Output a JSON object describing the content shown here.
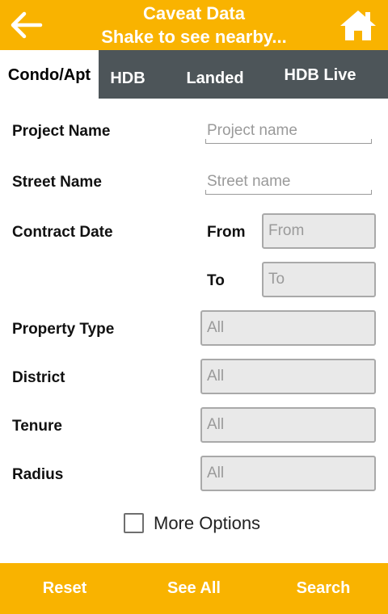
{
  "header": {
    "title": "Caveat Data",
    "subtitle": "Shake to see nearby...",
    "back_icon": "arrow-left-icon",
    "home_icon": "home-icon"
  },
  "tabs": [
    {
      "label": "Condo/Apt",
      "active": true
    },
    {
      "label": "HDB",
      "active": false
    },
    {
      "label": "Landed",
      "active": false
    },
    {
      "label": "HDB Live",
      "active": false
    }
  ],
  "form": {
    "project_name": {
      "label": "Project Name",
      "placeholder": "Project name"
    },
    "street_name": {
      "label": "Street Name",
      "placeholder": "Street name"
    },
    "contract_date": {
      "label": "Contract Date",
      "from_label": "From",
      "from_placeholder": "From",
      "to_label": "To",
      "to_placeholder": "To"
    },
    "property_type": {
      "label": "Property Type",
      "value": "All"
    },
    "district": {
      "label": "District",
      "value": "All"
    },
    "tenure": {
      "label": "Tenure",
      "value": "All"
    },
    "radius": {
      "label": "Radius",
      "value": "All"
    },
    "more_options": {
      "label": "More Options",
      "checked": false
    }
  },
  "footer": {
    "reset": "Reset",
    "see_all": "See All",
    "search": "Search"
  },
  "colors": {
    "accent": "#f9b300",
    "tab_bar": "#4d5559"
  }
}
